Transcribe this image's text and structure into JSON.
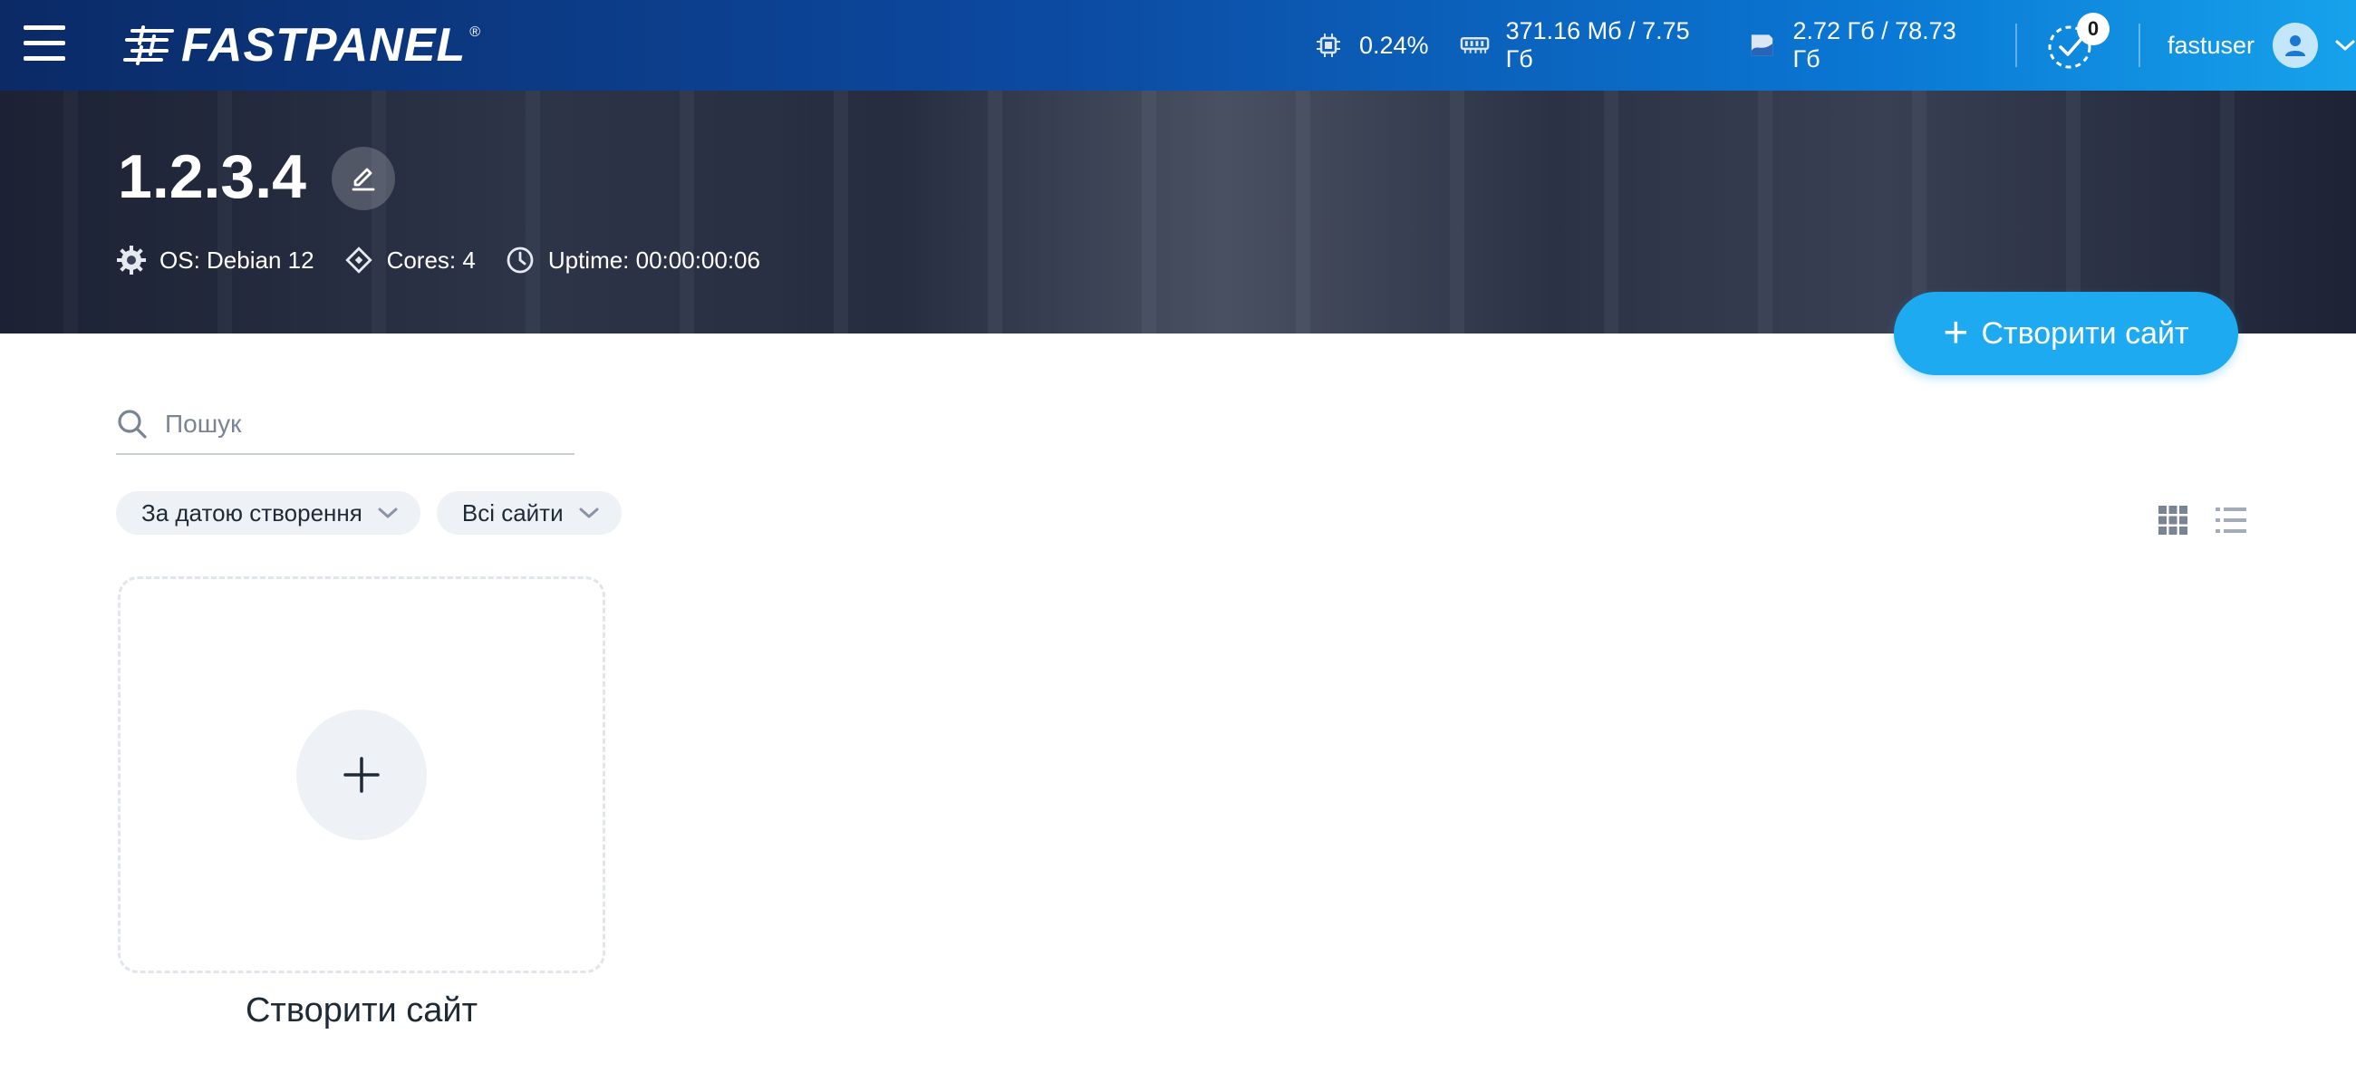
{
  "header": {
    "logo_text": "FASTPANEL",
    "logo_reg": "®",
    "cpu": "0.24%",
    "ram": "371.16 Мб / 7.75 Гб",
    "disk": "2.72 Гб / 78.73 Гб",
    "tasks_count": "0",
    "username": "fastuser"
  },
  "server": {
    "title": "1.2.3.4",
    "os": "OS: Debian 12",
    "cores": "Cores: 4",
    "uptime": "Uptime: 00:00:00:06"
  },
  "actions": {
    "create_site_label": "Створити сайт",
    "create_site_plus": "+"
  },
  "search": {
    "placeholder": "Пошук",
    "value": ""
  },
  "filters": {
    "sort_label": "За датою створення",
    "scope_label": "Всі сайти"
  },
  "new_site_card": {
    "plus": "+",
    "label": "Створити сайт"
  },
  "icons": {
    "menu": "hamburger-icon",
    "cpu": "cpu-chip-icon",
    "ram": "memory-icon",
    "disk": "disk-icon",
    "tasks": "task-check-icon",
    "user": "user-avatar-icon",
    "os": "gear-icon",
    "cores": "diamond-icon",
    "uptime": "clock-icon",
    "edit": "pencil-icon",
    "search": "search-icon",
    "grid": "grid-view-icon",
    "list": "list-view-icon"
  },
  "colors": {
    "primary": "#1eaaf1",
    "header_start": "#0b2a66",
    "header_end": "#16a2ec",
    "chip_bg": "#eef1f5",
    "text": "#1f2a37"
  }
}
